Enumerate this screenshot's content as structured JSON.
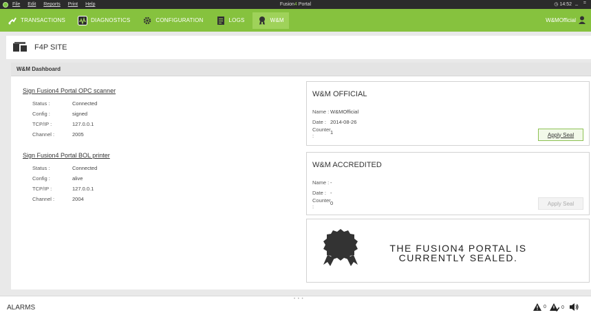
{
  "titlebar": {
    "menu": [
      "File",
      "Edit",
      "Reports",
      "Print",
      "Help"
    ],
    "title_prefix": "Fusion",
    "title_accent": "4",
    "title_suffix": " Portal",
    "time": "14:52",
    "controls": "_ ="
  },
  "toolbar": {
    "tabs": [
      {
        "label": "TRANSACTIONS",
        "icon": "transactions-icon"
      },
      {
        "label": "DIAGNOSTICS",
        "icon": "diagnostics-icon"
      },
      {
        "label": "CONFIGURATION",
        "icon": "gear-icon"
      },
      {
        "label": "LOGS",
        "icon": "logs-icon"
      },
      {
        "label": "W&M",
        "icon": "seal-icon",
        "active": true
      }
    ],
    "user": "W&MOfficial"
  },
  "site": {
    "label": "F4P SITE"
  },
  "dashboard": {
    "header": "W&M Dashboard",
    "devices": [
      {
        "title": "Sign Fusion4 Portal OPC scanner",
        "fields": [
          {
            "k": "Status :",
            "v": "Connected"
          },
          {
            "k": "Config :",
            "v": "signed"
          },
          {
            "k": "TCP/IP :",
            "v": "127.0.0.1"
          },
          {
            "k": "Channel :",
            "v": "2005"
          }
        ]
      },
      {
        "title": "Sign Fusion4 Portal BOL printer",
        "fields": [
          {
            "k": "Status :",
            "v": "Connected"
          },
          {
            "k": "Config :",
            "v": "alive"
          },
          {
            "k": "TCP/IP :",
            "v": "127.0.0.1"
          },
          {
            "k": "Channel :",
            "v": "2004"
          }
        ]
      }
    ],
    "official": {
      "title": "W&M OFFICIAL",
      "fields": [
        {
          "k": "Name :",
          "v": "W&MOfficial"
        },
        {
          "k": "Date :",
          "v": "2014-08-26"
        },
        {
          "k": "Counter :",
          "v": "1"
        }
      ],
      "button": "Apply Seal",
      "enabled": true
    },
    "accredited": {
      "title": "W&M ACCREDITED",
      "fields": [
        {
          "k": "Name :",
          "v": "-"
        },
        {
          "k": "Date :",
          "v": "-"
        },
        {
          "k": "Counter :",
          "v": "0"
        }
      ],
      "button": "Apply Seal",
      "enabled": false
    },
    "seal_message": "THE FUSION4 PORTAL IS CURRENTLY SEALED."
  },
  "alarms": {
    "title": "ALARMS",
    "warning_count": "0",
    "ack_count": "0",
    "grip": "• • •"
  },
  "colors": {
    "brand": "#86c23e",
    "titlebar": "#2b2b2b"
  }
}
